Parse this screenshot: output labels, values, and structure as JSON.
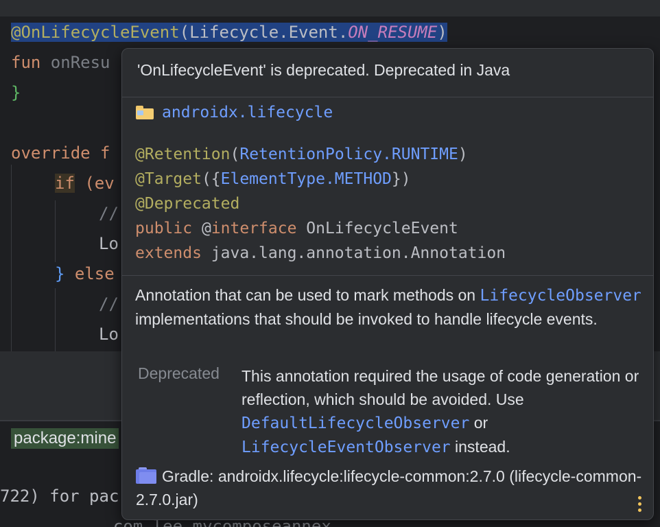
{
  "editor": {
    "line1": {
      "annotation": "@OnLifecycleEvent",
      "open": "(",
      "cls": "Lifecycle.Event.",
      "field": "ON_RESUME",
      "close": ")"
    },
    "line2": {
      "kw": "fun",
      "name": " onResu"
    },
    "line3": {
      "brace": "}"
    },
    "line5": {
      "kw": "override",
      "rest": " f"
    },
    "line6": {
      "kw": "if",
      "rest": " (ev"
    },
    "line7": {
      "comment": "//"
    },
    "line8": {
      "text": "Lo"
    },
    "line9": {
      "brace": "}",
      "kw": " else"
    },
    "line10": {
      "comment": "//"
    },
    "line11": {
      "text": "Lo"
    }
  },
  "bottom": {
    "package_search": "package:mine",
    "log_line1": "722) for pac",
    "log_line2": "  com.lee.mycomposeannex"
  },
  "popup": {
    "title": "'OnLifecycleEvent' is deprecated. Deprecated in Java",
    "package": "androidx.lifecycle",
    "sig": {
      "retention": "@Retention",
      "retention_arg": "RetentionPolicy.RUNTIME",
      "target": "@Target",
      "target_arg": "ElementType.METHOD",
      "deprecated": "@Deprecated",
      "public": "public",
      "at": "@",
      "interface": "interface",
      "class_name": "OnLifecycleEvent",
      "extends": "extends",
      "super": "java.lang.annotation.Annotation"
    },
    "description": {
      "part1": "Annotation that can be used to mark methods on",
      "link": "LifecycleObserver",
      "part2": "implementations that should be invoked to handle lifecycle events."
    },
    "deprecated": {
      "label": "Deprecated",
      "part1": "This annotation required the usage of code generation or reflection, which should be avoided. Use",
      "link1": "DefaultLifecycleObserver",
      "or": "or",
      "link2": "LifecycleEventObserver",
      "part2": "instead."
    },
    "gradle": "Gradle: androidx.lifecycle:lifecycle-common:2.7.0 (lifecycle-common-2.7.0.jar)"
  }
}
